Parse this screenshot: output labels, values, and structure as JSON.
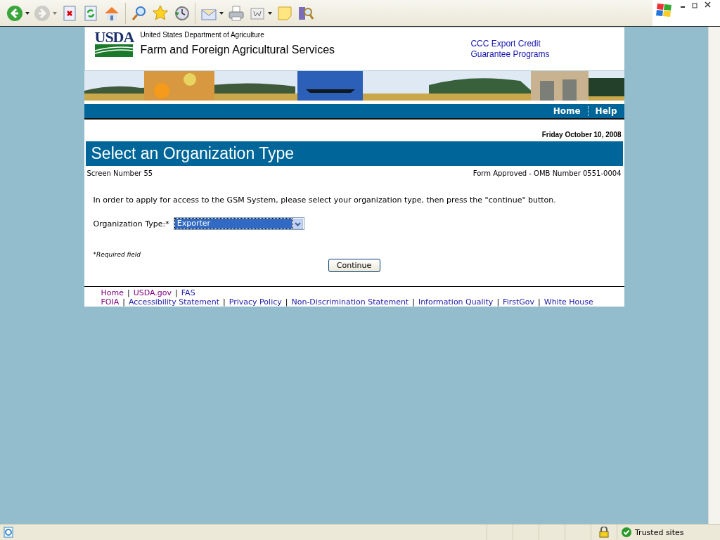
{
  "toolbar": {
    "buttons": [
      {
        "kind": "back",
        "disabled": false,
        "dropdown": true
      },
      {
        "kind": "forward",
        "disabled": true,
        "dropdown": true
      },
      {
        "kind": "stop",
        "disabled": false,
        "dropdown": false
      },
      {
        "kind": "refresh",
        "disabled": false,
        "dropdown": false
      },
      {
        "kind": "home",
        "disabled": false,
        "dropdown": false
      },
      {
        "kind": "sep"
      },
      {
        "kind": "search",
        "disabled": false,
        "dropdown": false
      },
      {
        "kind": "favorites",
        "disabled": false,
        "dropdown": false
      },
      {
        "kind": "history",
        "disabled": false,
        "dropdown": false
      },
      {
        "kind": "sep"
      },
      {
        "kind": "mail",
        "disabled": false,
        "dropdown": true
      },
      {
        "kind": "print",
        "disabled": false,
        "dropdown": false
      },
      {
        "kind": "word",
        "disabled": false,
        "dropdown": true
      },
      {
        "kind": "note",
        "disabled": false,
        "dropdown": false
      },
      {
        "kind": "research",
        "disabled": false,
        "dropdown": false
      }
    ]
  },
  "header": {
    "agency": "United States Department of Agriculture",
    "logo": "USDA",
    "title": "Farm and Foreign Agricultural Services",
    "program_link": [
      "CCC Export Credit",
      "Guarantee Programs"
    ]
  },
  "nav": [
    {
      "label": "Home"
    },
    {
      "label": "Help"
    }
  ],
  "date": "Friday October 10, 2008",
  "page_title": "Select an Organization Type",
  "screen_number": "Screen Number 55",
  "omb": "Form Approved - OMB Number 0551-0004",
  "instructions": "In order to apply for access to the GSM System, please select your organization type, then press the \"continue\" button.",
  "form": {
    "label": "Organization Type:*",
    "value": "Exporter",
    "focused": true,
    "required_note": "*Required field",
    "button": "Continue"
  },
  "footer": {
    "site_links": [
      {
        "label": "Home",
        "visited": true
      },
      {
        "label": "USDA.gov",
        "visited": true
      },
      {
        "label": "FAS",
        "visited": false
      }
    ],
    "policy_links": [
      {
        "label": "FOIA",
        "visited": true
      },
      {
        "label": "Accessibility Statement",
        "visited": false
      },
      {
        "label": "Privacy Policy",
        "visited": false
      },
      {
        "label": "Non-Discrimination Statement",
        "visited": false
      },
      {
        "label": "Information Quality",
        "visited": false
      },
      {
        "label": "FirstGov",
        "visited": false
      },
      {
        "label": "White House",
        "visited": false
      }
    ],
    "separator": "|"
  },
  "status_bar": {
    "zone": "Trusted sites"
  }
}
